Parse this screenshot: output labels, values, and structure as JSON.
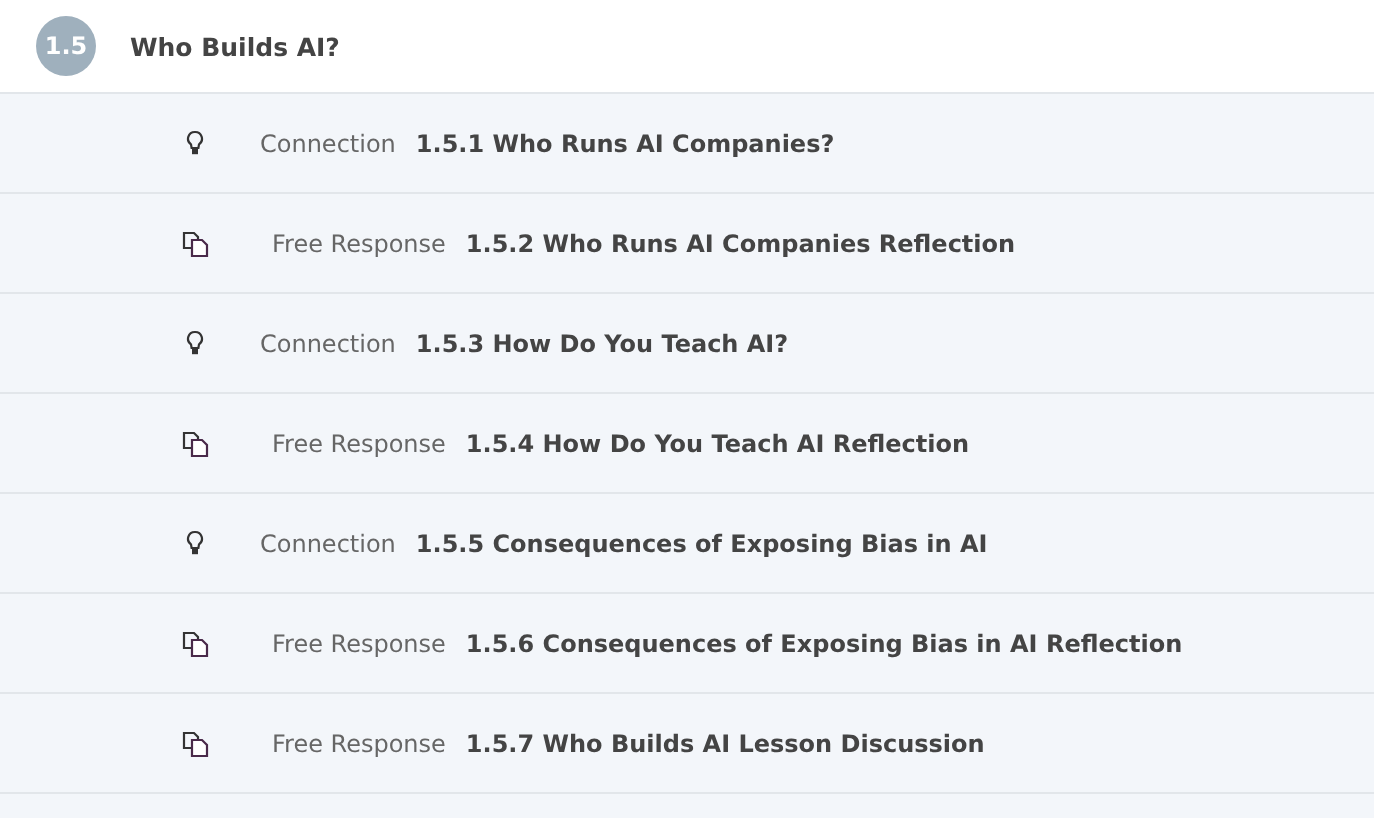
{
  "section": {
    "number": "1.5",
    "title": "Who Builds AI?"
  },
  "items": [
    {
      "kind": "connection",
      "type": "Connection",
      "title": "1.5.1 Who Runs AI Companies?"
    },
    {
      "kind": "response",
      "type": "Free Response",
      "title": "1.5.2 Who Runs AI Companies Reflection"
    },
    {
      "kind": "connection",
      "type": "Connection",
      "title": "1.5.3 How Do You Teach AI?"
    },
    {
      "kind": "response",
      "type": "Free Response",
      "title": "1.5.4 How Do You Teach AI Reflection"
    },
    {
      "kind": "connection",
      "type": "Connection",
      "title": "1.5.5 Consequences of Exposing Bias in AI"
    },
    {
      "kind": "response",
      "type": "Free Response",
      "title": "1.5.6 Consequences of Exposing Bias in AI Reflection"
    },
    {
      "kind": "response",
      "type": "Free Response",
      "title": "1.5.7 Who Builds AI Lesson Discussion"
    }
  ]
}
